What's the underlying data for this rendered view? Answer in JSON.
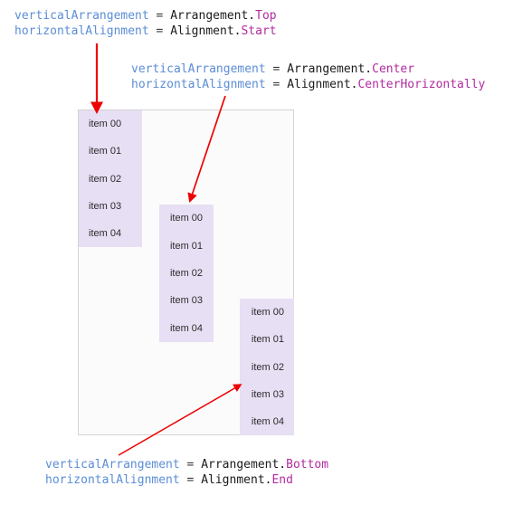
{
  "labels": {
    "top": {
      "line1": {
        "prop": "verticalArrangement",
        "eq": " = ",
        "type": "Arrangement",
        "dot": ".",
        "member": "Top"
      },
      "line2": {
        "prop": "horizontalAlignment",
        "eq": "  = ",
        "type": "Alignment",
        "dot": ".",
        "member": "Start"
      }
    },
    "center": {
      "line1": {
        "prop": "verticalArrangement",
        "eq": " = ",
        "type": "Arrangement",
        "dot": ".",
        "member": "Center"
      },
      "line2": {
        "prop": "horizontalAlignment",
        "eq": "  = ",
        "type": "Alignment",
        "dot": ".",
        "member": "CenterHorizontally"
      }
    },
    "bottom": {
      "line1": {
        "prop": "verticalArrangement",
        "eq": " = ",
        "type": "Arrangement",
        "dot": ".",
        "member": "Bottom"
      },
      "line2": {
        "prop": "horizontalAlignment",
        "eq": "  = ",
        "type": "Alignment",
        "dot": ".",
        "member": "End"
      }
    }
  },
  "columns": {
    "top": {
      "items": [
        "item 00",
        "item 01",
        "item 02",
        "item 03",
        "item 04"
      ]
    },
    "center": {
      "items": [
        "item 00",
        "item 01",
        "item 02",
        "item 03",
        "item 04"
      ]
    },
    "bottom": {
      "items": [
        "item 00",
        "item 01",
        "item 02",
        "item 03",
        "item 04"
      ]
    }
  },
  "colors": {
    "property": "#5b8dd6",
    "type": "#1b1b1b",
    "member": "#b32ba0",
    "item_fill": "#e7dff4",
    "container_fill": "#fbfbfb",
    "container_border": "#d3d3d3",
    "arrow": "#ee0000"
  },
  "arrows": {
    "to_top": {
      "name": "arrow-to-top-column"
    },
    "to_center": {
      "name": "arrow-to-center-column"
    },
    "to_bottom": {
      "name": "arrow-to-bottom-column"
    }
  }
}
